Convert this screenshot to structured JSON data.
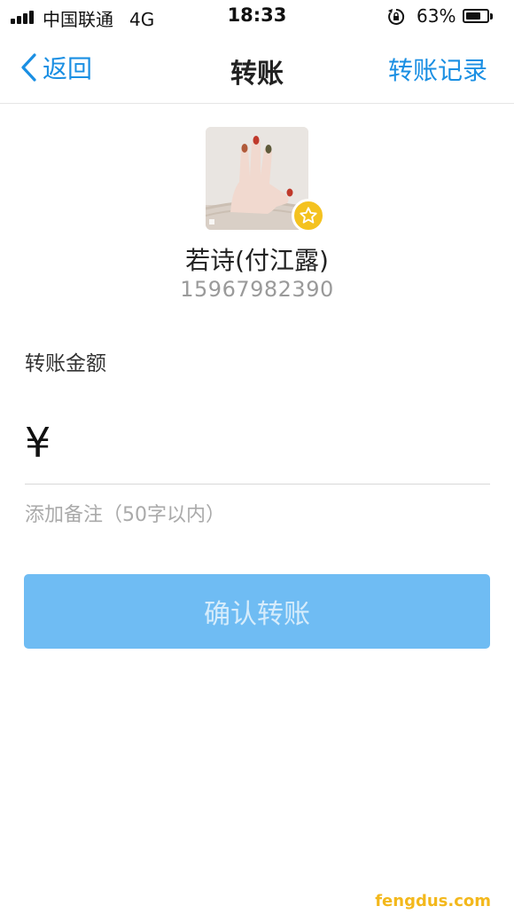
{
  "status_bar": {
    "carrier": "中国联通",
    "network": "4G",
    "time": "18:33",
    "battery_percent": "63%",
    "battery_level": 0.63
  },
  "nav": {
    "back_label": "返回",
    "title": "转账",
    "history_label": "转账记录",
    "accent_color": "#1a8fe3"
  },
  "recipient": {
    "avatar": "hand-photo",
    "badge": "star-icon",
    "name": "若诗(付江露)",
    "phone": "15967982390"
  },
  "form": {
    "amount_label": "转账金额",
    "currency_symbol": "¥",
    "amount_value": "",
    "note_placeholder": "添加备注（50字以内）"
  },
  "confirm": {
    "label": "确认转账",
    "background": "#6fbcf3"
  },
  "watermark": "fengdus.com"
}
